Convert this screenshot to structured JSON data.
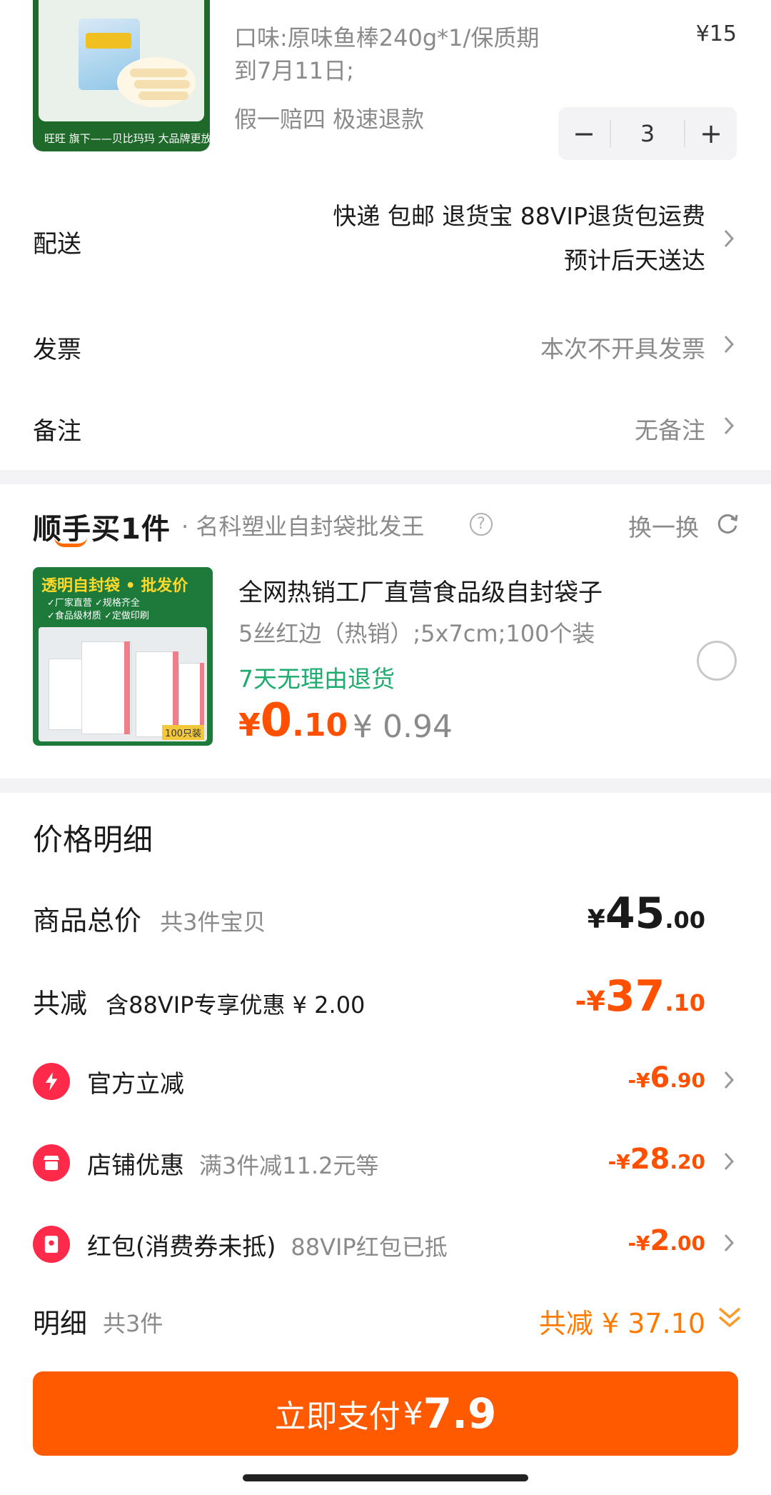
{
  "product": {
    "spec": "口味:原味鱼棒240g*1/保质期到7月11日;",
    "guarantee": "假一赔四  极速退款",
    "price": "¥15",
    "quantity": "3",
    "decrease": "−",
    "increase": "+",
    "image_brand": "旺旺 旗下——贝比玛玛  大品牌更放心"
  },
  "delivery": {
    "label": "配送",
    "line1": "快递 包邮 退货宝 88VIP退货包运费",
    "line2": "预计后天送达"
  },
  "invoice": {
    "label": "发票",
    "value": "本次不开具发票"
  },
  "remark": {
    "label": "备注",
    "value": "无备注"
  },
  "addon": {
    "logo": "顺手买1件",
    "shop": "· 名科塑业自封袋批发王",
    "help": "?",
    "swap": "换一换",
    "image_title": "透明自封袋 • 批发价",
    "image_sub1": "✓厂家直营  ✓规格齐全",
    "image_sub2": "✓食品级材质  ✓定做印刷",
    "image_count": "100只装",
    "title": "全网热销工厂直营食品级自封袋子",
    "spec": "5丝红边（热销）;5x7cm;100个装",
    "return": "7天无理由退货",
    "price_symbol": "¥",
    "price_int": "0",
    "price_dec": ".10",
    "orig_price": "¥ 0.94"
  },
  "price_detail": {
    "title": "价格明细",
    "total_label": "商品总价",
    "total_sub": "共3件宝贝",
    "total_cur": "¥",
    "total_int": "45",
    "total_dec": ".00",
    "reduce_label": "共减",
    "reduce_sub": "含88VIP专享优惠 ¥ 2.00",
    "reduce_cur": "-¥",
    "reduce_int": "37",
    "reduce_dec": ".10",
    "items": [
      {
        "label": "官方立减",
        "sub": "",
        "cur": "-¥",
        "int": "6",
        "dec": ".90"
      },
      {
        "label": "店铺优惠",
        "sub": "满3件减11.2元等",
        "cur": "-¥",
        "int": "28",
        "dec": ".20"
      },
      {
        "label": "红包(消费券未抵)",
        "sub": "88VIP红包已抵",
        "cur": "-¥",
        "int": "2",
        "dec": ".00"
      }
    ],
    "detail_label": "明细",
    "detail_sub": "共3件",
    "detail_total": "共减 ¥ 37.10"
  },
  "pay": {
    "label": "立即支付",
    "cur": "¥",
    "amount": "7.9"
  },
  "colors": {
    "accent": "#ff5000",
    "green": "#1eab6e",
    "icon_red": "#ff2a4a"
  }
}
